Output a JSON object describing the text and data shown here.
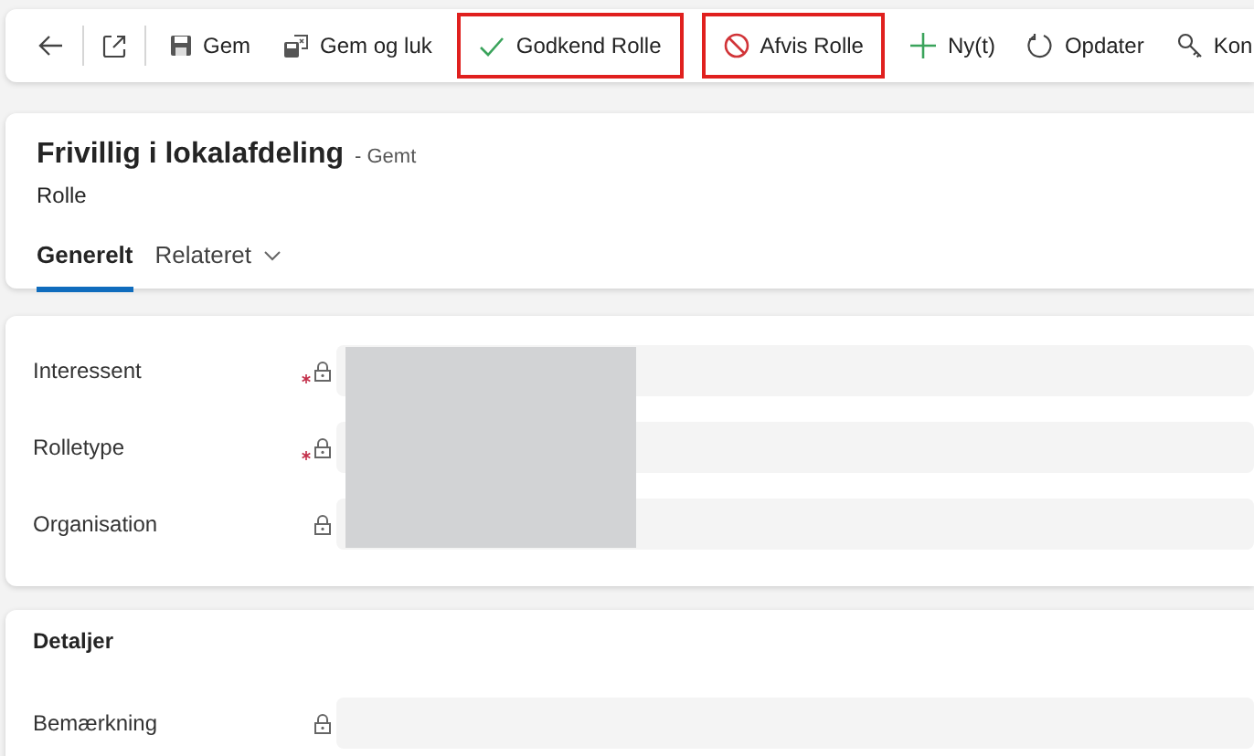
{
  "toolbar": {
    "items": [
      {
        "kind": "back"
      },
      {
        "kind": "divider"
      },
      {
        "kind": "popout"
      },
      {
        "kind": "divider"
      },
      {
        "kind": "save",
        "label": "Gem",
        "highlighted": false
      },
      {
        "kind": "saveclose",
        "label": "Gem og luk",
        "highlighted": false
      },
      {
        "kind": "approve",
        "label": "Godkend Rolle",
        "highlighted": true
      },
      {
        "kind": "reject",
        "label": "Afvis Rolle",
        "highlighted": true
      },
      {
        "kind": "new",
        "label": "Ny(t)",
        "highlighted": false
      },
      {
        "kind": "refresh",
        "label": "Opdater",
        "highlighted": false
      },
      {
        "kind": "key",
        "label": "Kon",
        "highlighted": false
      }
    ]
  },
  "header": {
    "title": "Frivillig i lokalafdeling",
    "status": "- Gemt",
    "entity": "Rolle",
    "tabs": [
      {
        "label": "Generelt",
        "selected": true,
        "dropdown": false
      },
      {
        "label": "Relateret",
        "selected": false,
        "dropdown": true
      }
    ]
  },
  "general": {
    "fields": [
      {
        "label": "Interessent",
        "required": true,
        "locked": true
      },
      {
        "label": "Rolletype",
        "required": true,
        "locked": true
      },
      {
        "label": "Organisation",
        "required": false,
        "locked": true
      }
    ]
  },
  "details": {
    "title": "Detaljer",
    "fields": [
      {
        "label": "Bemærkning",
        "required": false,
        "locked": true
      }
    ]
  }
}
